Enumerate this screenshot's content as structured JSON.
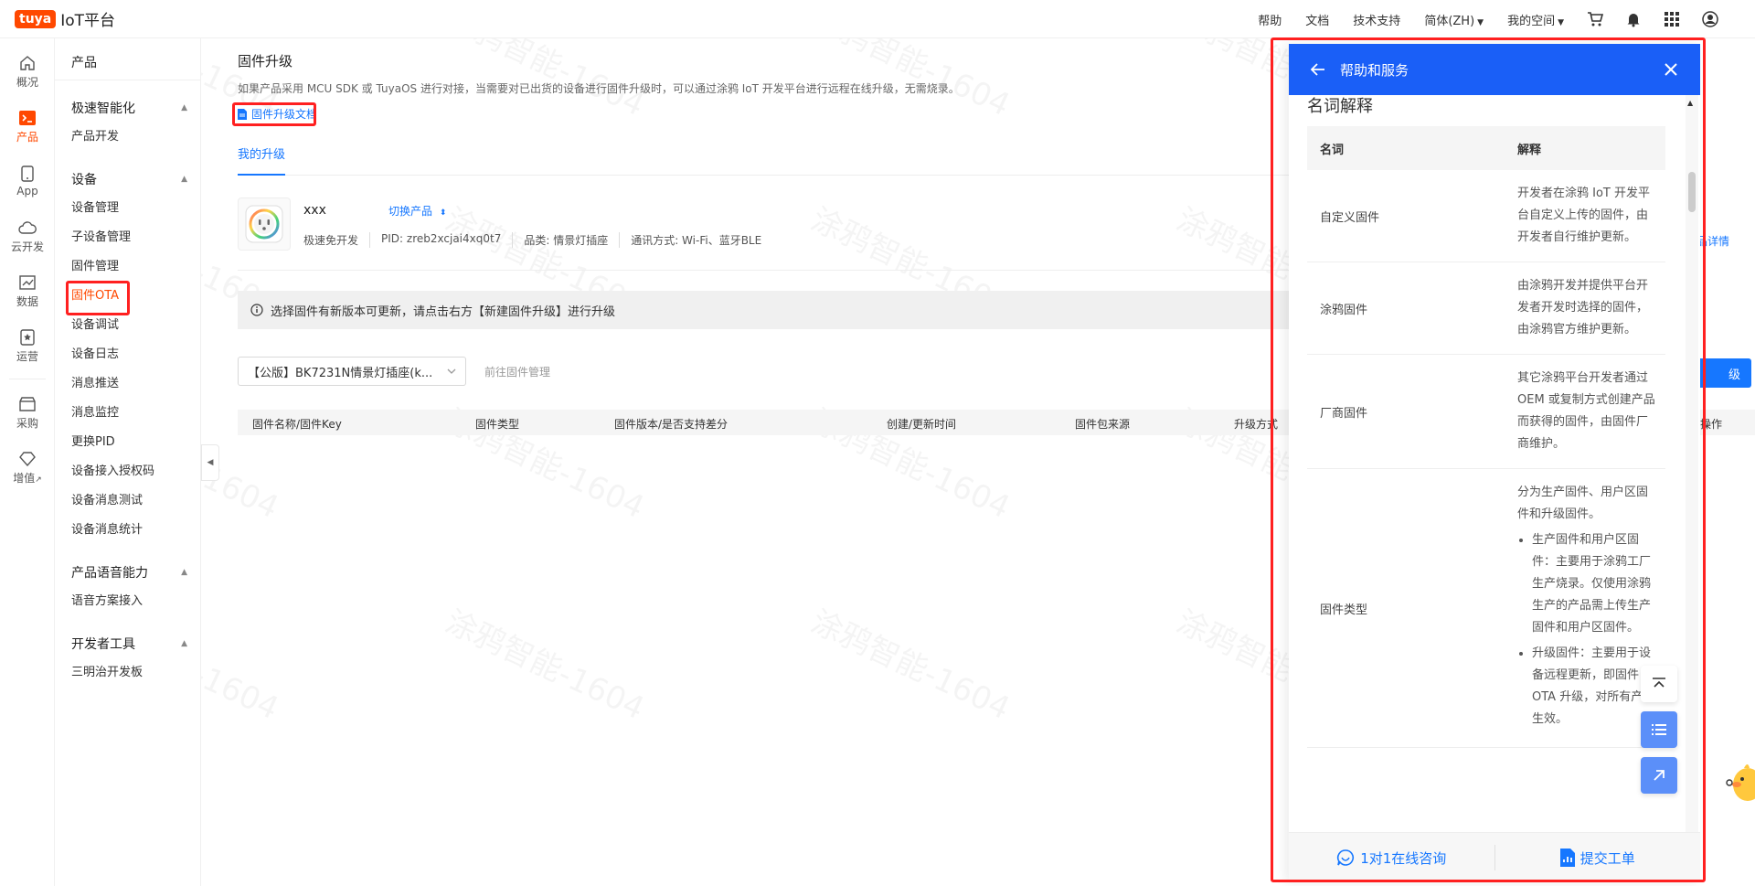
{
  "topbar": {
    "brand": "tuya",
    "title": "IoT平台",
    "nav": [
      "帮助",
      "文档",
      "技术支持"
    ],
    "language": "简体(ZH)",
    "space": "我的空间",
    "icons": [
      "cart-icon",
      "bell-icon",
      "grid-apps-icon",
      "user-avatar-icon"
    ]
  },
  "rail": [
    {
      "label": "概况",
      "icon": "home-icon"
    },
    {
      "label": "产品",
      "icon": "terminal-icon",
      "active": true
    },
    {
      "label": "App",
      "icon": "phone-icon"
    },
    {
      "label": "云开发",
      "icon": "cloud-icon"
    },
    {
      "label": "数据",
      "icon": "chart-icon"
    },
    {
      "label": "运营",
      "icon": "operate-icon"
    },
    {
      "label": "采购",
      "icon": "shop-icon"
    },
    {
      "label": "增值",
      "icon": "diamond-icon"
    }
  ],
  "subnav": {
    "title": "产品",
    "groups": [
      {
        "label": "极速智能化",
        "items": [
          "产品开发"
        ]
      },
      {
        "label": "设备",
        "items": [
          "设备管理",
          "子设备管理",
          "固件管理",
          "固件OTA",
          "设备调试",
          "设备日志",
          "消息推送",
          "消息监控",
          "更换PID",
          "设备接入授权码",
          "设备消息测试",
          "设备消息统计"
        ]
      },
      {
        "label": "产品语音能力",
        "items": [
          "语音方案接入"
        ]
      },
      {
        "label": "开发者工具",
        "items": [
          "三明治开发板"
        ]
      }
    ]
  },
  "main": {
    "title": "固件升级",
    "description": "如果产品采用 MCU SDK 或 TuyaOS 进行对接，当需要对已出货的设备进行固件升级时，可以通过涂鸦 IoT 开发平台进行远程在线升级，无需烧录。",
    "doc_link": "固件升级文档",
    "tab": "我的升级",
    "product": {
      "name": "xxx",
      "switch": "切换产品",
      "meta": [
        "极速免开发",
        "PID:  zreb2xcjai4xq0t7",
        "品类:  情景灯插座",
        "通讯方式:  Wi-Fi、蓝牙BLE"
      ]
    },
    "info": "选择固件有新版本可更新，请点击右方【新建固件升级】进行升级",
    "firmware_select": "【公版】BK7231N情景灯插座(k...",
    "goto_fw": "前往固件管理",
    "table_headers": [
      "固件名称/固件Key",
      "固件类型",
      "固件版本/是否支持差分",
      "创建/更新时间",
      "固件包来源",
      "升级方式",
      "操作"
    ],
    "right_link_partial": "品详情",
    "right_button_partial": "级"
  },
  "help": {
    "title": "帮助和服务",
    "section": "名词解释",
    "headers": [
      "名词",
      "解释"
    ],
    "rows": [
      {
        "term": "自定义固件",
        "def": "开发者在涂鸦 IoT 开发平台自定义上传的固件，由开发者自行维护更新。"
      },
      {
        "term": "涂鸦固件",
        "def": "由涂鸦开发并提供平台开发者开发时选择的固件，由涂鸦官方维护更新。"
      },
      {
        "term": "厂商固件",
        "def": "其它涂鸦平台开发者通过 OEM 或复制方式创建产品而获得的固件，由固件厂商维护。"
      },
      {
        "term": "固件类型",
        "def": "分为生产固件、用户区固件和升级固件。",
        "bullets": [
          "生产固件和用户区固件：主要用于涂鸦工厂生产烧录。仅使用涂鸦生产的产品需上传生产固件和用户区固件。",
          "升级固件：主要用于设备远程更新，即固件 OTA 升级，对所有产品生效。"
        ]
      }
    ],
    "footer": {
      "consult": "1对1在线咨询",
      "ticket": "提交工单"
    }
  },
  "watermark_text": "涂鸦智能-1604",
  "colors": {
    "brand": "#ff4800",
    "primary": "#1677ff",
    "help_header": "#1a5ff7",
    "highlight": "#ff2020"
  }
}
